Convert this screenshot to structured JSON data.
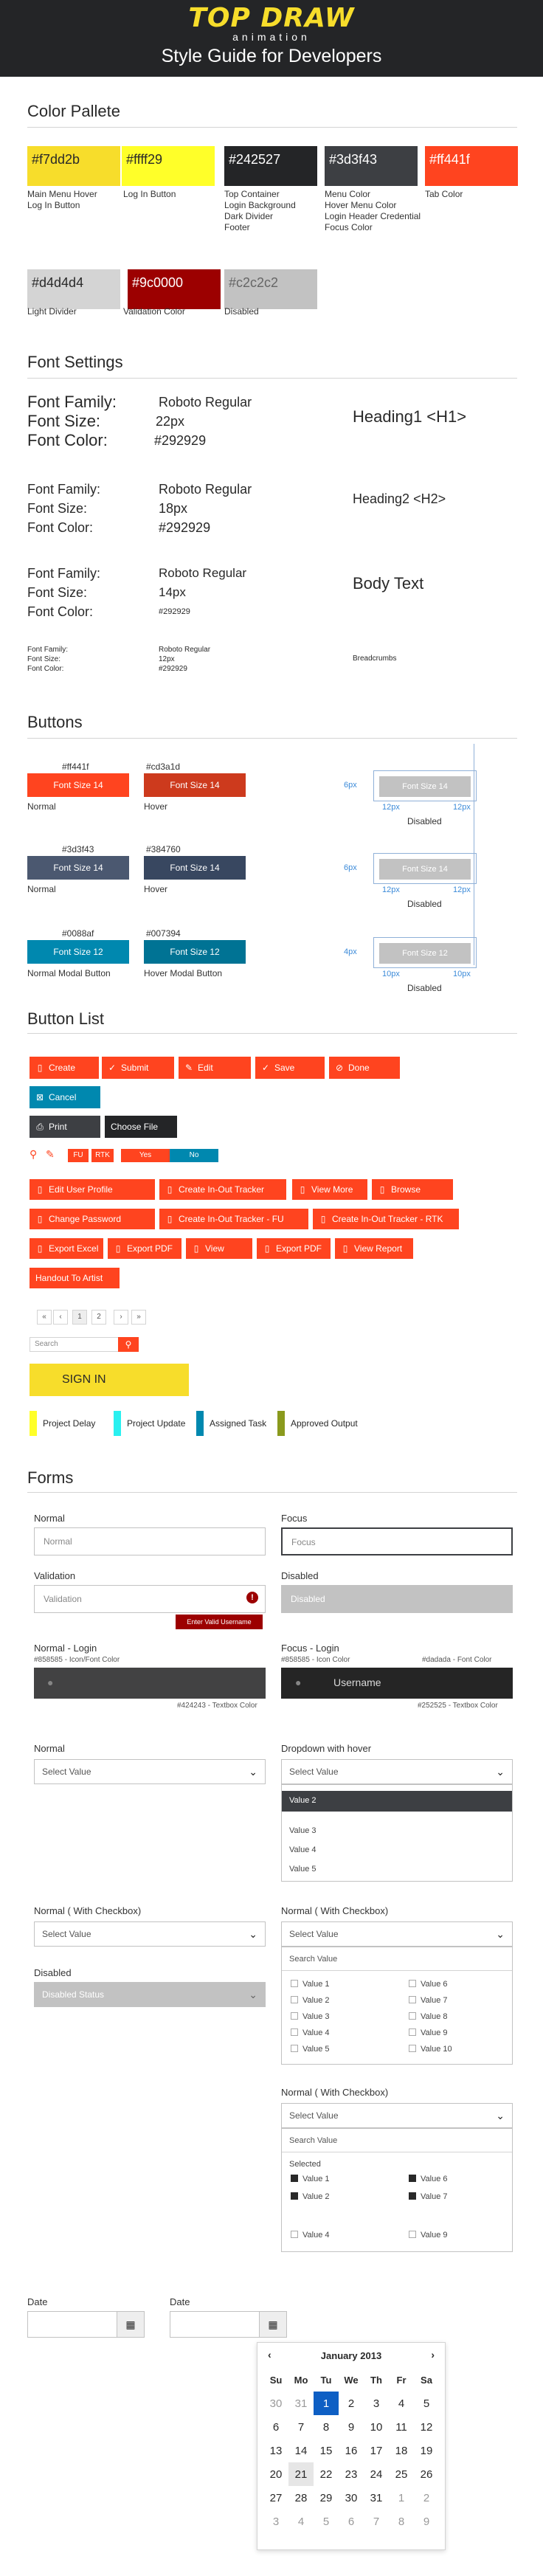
{
  "header": {
    "logo_title": "TOP DRAW",
    "logo_sub": "animation",
    "title": "Style Guide for Developers"
  },
  "palette": {
    "title": "Color Pallete",
    "swatches": [
      {
        "hex": "#f7dd2b",
        "label": "Main Menu Hover\nLog In Button",
        "color": "#f7dd2b",
        "text": "#292929"
      },
      {
        "hex": "#ffff29",
        "label": "Log In Button",
        "color": "#ffff29",
        "text": "#292929"
      },
      {
        "hex": "#242527",
        "label": "Top Container\nLogin Background\nDark Divider\nFooter",
        "color": "#242527",
        "text": "#ffffff"
      },
      {
        "hex": "#3d3f43",
        "label": "Menu Color\nHover Menu Color\nLogin Header Credential\nFocus Color",
        "color": "#3d3f43",
        "text": "#ffffff"
      },
      {
        "hex": "#ff441f",
        "label": "Tab Color",
        "color": "#ff441f",
        "text": "#ffffff"
      },
      {
        "hex": "#d4d4d4",
        "label": "Light Divider",
        "color": "#d4d4d4",
        "text": "#292929"
      },
      {
        "hex": "#9c0000",
        "label": "Validation Color",
        "color": "#9c0000",
        "text": "#ffffff"
      },
      {
        "hex": "#c2c2c2",
        "label": "Disabled",
        "color": "#c2c2c2",
        "text": "#666666"
      }
    ]
  },
  "fonts": {
    "title": "Font Settings",
    "labels": [
      "Font Family:",
      "Font Size:",
      "Font Color:"
    ],
    "rows": [
      {
        "family": "Roboto Regular",
        "size": "22px",
        "color": "#292929",
        "sample": "Heading1 <H1>"
      },
      {
        "family": "Roboto Regular",
        "size": "18px",
        "color": "#292929",
        "sample": "Heading2 <H2>"
      },
      {
        "family": "Roboto Regular",
        "size": "14px",
        "color": "#292929",
        "sample": "Body Text"
      },
      {
        "family": "Roboto Regular",
        "size": "12px",
        "color": "#292929",
        "sample": "Breadcrumbs"
      }
    ]
  },
  "buttons": {
    "title": "Buttons",
    "sample": "Font Size 14",
    "sample_small": "Font Size 12",
    "disabled": "Disabled",
    "rows": [
      {
        "n_hex": "#ff441f",
        "h_hex": "#cd3a1d",
        "n_color": "#ff441f",
        "h_color": "#cd3a1d",
        "n_label": "Normal",
        "h_label": "Hover",
        "text": "Font Size 14"
      },
      {
        "n_hex": "#3d3f43",
        "h_hex": "#384760",
        "n_color": "#4b5870",
        "h_color": "#384760",
        "n_label": "Normal",
        "h_label": "Hover",
        "text": "Font Size 14"
      },
      {
        "n_hex": "#0088af",
        "h_hex": "#007394",
        "n_color": "#0088af",
        "h_color": "#007394",
        "n_label": "Normal Modal Button",
        "h_label": "Hover Modal Button",
        "text": "Font Size 12"
      }
    ],
    "pad": [
      "6px",
      "12px",
      "12px",
      "6px",
      "12px",
      "12px",
      "4px",
      "10px",
      "10px"
    ]
  },
  "buttonlist": {
    "title": "Button List",
    "row1": [
      "Create",
      "Submit",
      "Edit",
      "Save",
      "Done"
    ],
    "cancel": "Cancel",
    "print": "Print",
    "choose": "Choose File",
    "fu": "FU",
    "rtk": "RTK",
    "yes": "Yes",
    "no": "No",
    "row4": [
      "Edit User Profile",
      "Create In-Out Tracker",
      "View More",
      "Browse"
    ],
    "row5": [
      "Change Password",
      "Create In-Out Tracker - FU",
      "Create In-Out Tracker - RTK"
    ],
    "row6": [
      "Export Excel",
      "Export PDF",
      "View Report",
      "Export PDF",
      "View Report"
    ],
    "handout": "Handout To Artist",
    "pager": [
      "«",
      "‹",
      "1",
      "2",
      "›",
      "»"
    ],
    "search_ph": "Search",
    "signin": "SIGN IN",
    "tags": [
      {
        "label": "Project Delay",
        "color": "#ffff29"
      },
      {
        "label": "Project Update",
        "color": "#29f0f0"
      },
      {
        "label": "Assigned Task",
        "color": "#0088af"
      },
      {
        "label": "Approved Output",
        "color": "#8a9a1d"
      }
    ]
  },
  "forms": {
    "title": "Forms",
    "normal": "Normal",
    "normal_ph": "Normal",
    "focus": "Focus",
    "focus_ph": "Focus",
    "validation": "Validation",
    "validation_ph": "Validation",
    "validation_msg": "Enter Valid Username",
    "disabled": "Disabled",
    "disabled_ph": "Disabled",
    "login_normal": "Normal - Login",
    "login_focus": "Focus - Login",
    "ln_hint": "#858585 - Icon/Font Color",
    "lf_hint1": "#858585 - Icon Color",
    "lf_hint2": "#dadada - Font Color",
    "username": "Username",
    "ln_bg": "#424243 - Textbox Color",
    "lf_bg": "#252525 - Textbox Color",
    "select_label": "Normal",
    "select_value": "Select Value",
    "hover_label": "Dropdown with hover",
    "hover_options": [
      "Value 2",
      "Value 3",
      "Value 4",
      "Value 5"
    ],
    "chk_label": "Normal ( With Checkbox)",
    "search_ph": "Search Value",
    "values_left": [
      "Value 1",
      "Value 2",
      "Value 3",
      "Value 4",
      "Value 5"
    ],
    "values_right": [
      "Value 6",
      "Value 7",
      "Value 8",
      "Value 9",
      "Value 10"
    ],
    "disabled_label": "Disabled",
    "disabled_status": "Disabled Status",
    "selected": "Selected",
    "sel_left": [
      "Value 1",
      "Value 2"
    ],
    "sel_right": [
      "Value 6",
      "Value 7"
    ],
    "unsel_left": [
      "Value 4"
    ],
    "unsel_right": [
      "Value 9"
    ],
    "date": "Date",
    "month": "January 2013",
    "days": [
      "Su",
      "Mo",
      "Tu",
      "We",
      "Th",
      "Fr",
      "Sa"
    ],
    "weeks": [
      [
        "30",
        "31",
        "1",
        "2",
        "3",
        "4",
        "5"
      ],
      [
        "6",
        "7",
        "8",
        "9",
        "10",
        "11",
        "12"
      ],
      [
        "13",
        "14",
        "15",
        "16",
        "17",
        "18",
        "19"
      ],
      [
        "20",
        "21",
        "22",
        "23",
        "24",
        "25",
        "26"
      ],
      [
        "27",
        "28",
        "29",
        "30",
        "31",
        "1",
        "2"
      ],
      [
        "3",
        "4",
        "5",
        "6",
        "7",
        "8",
        "9"
      ]
    ]
  }
}
